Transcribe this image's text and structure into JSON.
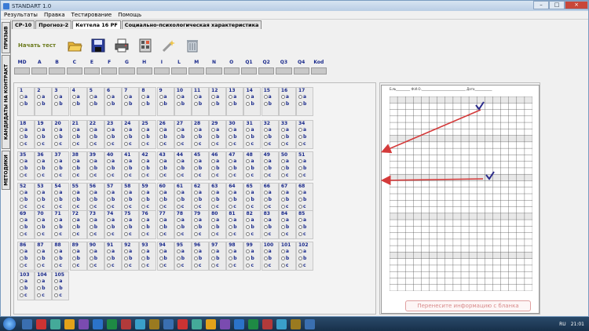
{
  "window": {
    "title": "STANDART 1.0",
    "controls": {
      "minimize": "–",
      "maximize": "□",
      "close": "×"
    }
  },
  "menu": [
    "Результаты",
    "Правка",
    "Тестирование",
    "Помощь"
  ],
  "sidetabs": [
    "ПРИЗЫВ",
    "КАНДИДАТЫ НА КОНТРАКТ",
    "МЕТОДИКИ"
  ],
  "testtabs": [
    "СР-10",
    "Прогноз-2",
    "Кеттела 16 PF",
    "Социально-психологическая характеристика"
  ],
  "toolbar": {
    "start_label": "Начать тест",
    "icons": [
      "open-folder-icon",
      "save-disk-icon",
      "print-icon",
      "calculator-icon",
      "magic-wand-icon",
      "trash-bin-icon"
    ]
  },
  "scales": [
    "MD",
    "A",
    "B",
    "C",
    "E",
    "F",
    "G",
    "H",
    "I",
    "L",
    "M",
    "N",
    "O",
    "Q1",
    "Q2",
    "Q3",
    "Q4",
    "Kod"
  ],
  "answers": {
    "options_3": [
      "a",
      "b",
      "c"
    ],
    "options_2": [
      "a",
      "b"
    ]
  },
  "questions": {
    "rows": [
      [
        "1",
        "2",
        "3",
        "4",
        "5",
        "6",
        "7",
        "8",
        "9",
        "10",
        "11",
        "12",
        "13",
        "14",
        "15",
        "16",
        "17"
      ],
      [
        "18",
        "19",
        "20",
        "21",
        "22",
        "23",
        "24",
        "25",
        "26",
        "27",
        "28",
        "29",
        "30",
        "31",
        "32",
        "33",
        "34"
      ],
      [
        "35",
        "36",
        "37",
        "38",
        "39",
        "40",
        "41",
        "42",
        "43",
        "44",
        "45",
        "46",
        "47",
        "48",
        "49",
        "50",
        "51"
      ],
      [
        "52",
        "53",
        "54",
        "55",
        "56",
        "57",
        "58",
        "59",
        "60",
        "61",
        "62",
        "63",
        "64",
        "65",
        "66",
        "67",
        "68"
      ],
      [
        "69",
        "70",
        "71",
        "72",
        "73",
        "74",
        "75",
        "76",
        "77",
        "78",
        "79",
        "80",
        "81",
        "82",
        "83",
        "84",
        "85"
      ],
      [
        "86",
        "87",
        "88",
        "89",
        "90",
        "91",
        "92",
        "93",
        "94",
        "95",
        "96",
        "97",
        "98",
        "99",
        "100",
        "101",
        "102"
      ],
      [
        "103",
        "104",
        "105"
      ]
    ]
  },
  "blank": {
    "header": "Б.№_________ Ф.И.О.____________________________ Дата___________",
    "transfer_button": "Перенесите информацию с бланка"
  },
  "taskbar": {
    "tray_lang": "RU",
    "clock": "21:01",
    "icons": [
      "explorer-icon",
      "opera-icon",
      "chrome-icon",
      "media-icon",
      "folder-icon",
      "word-icon",
      "excel-icon",
      "app-icon",
      "app-icon",
      "app-icon",
      "app-icon",
      "app-icon",
      "app-icon",
      "app-icon",
      "app-icon",
      "app-icon",
      "app-icon",
      "app-icon",
      "app-icon",
      "app-icon",
      "app-icon"
    ]
  },
  "colors": {
    "accent": "#1a2a8c",
    "arrow": "#d43a3a",
    "taskbar": "#17304a"
  }
}
